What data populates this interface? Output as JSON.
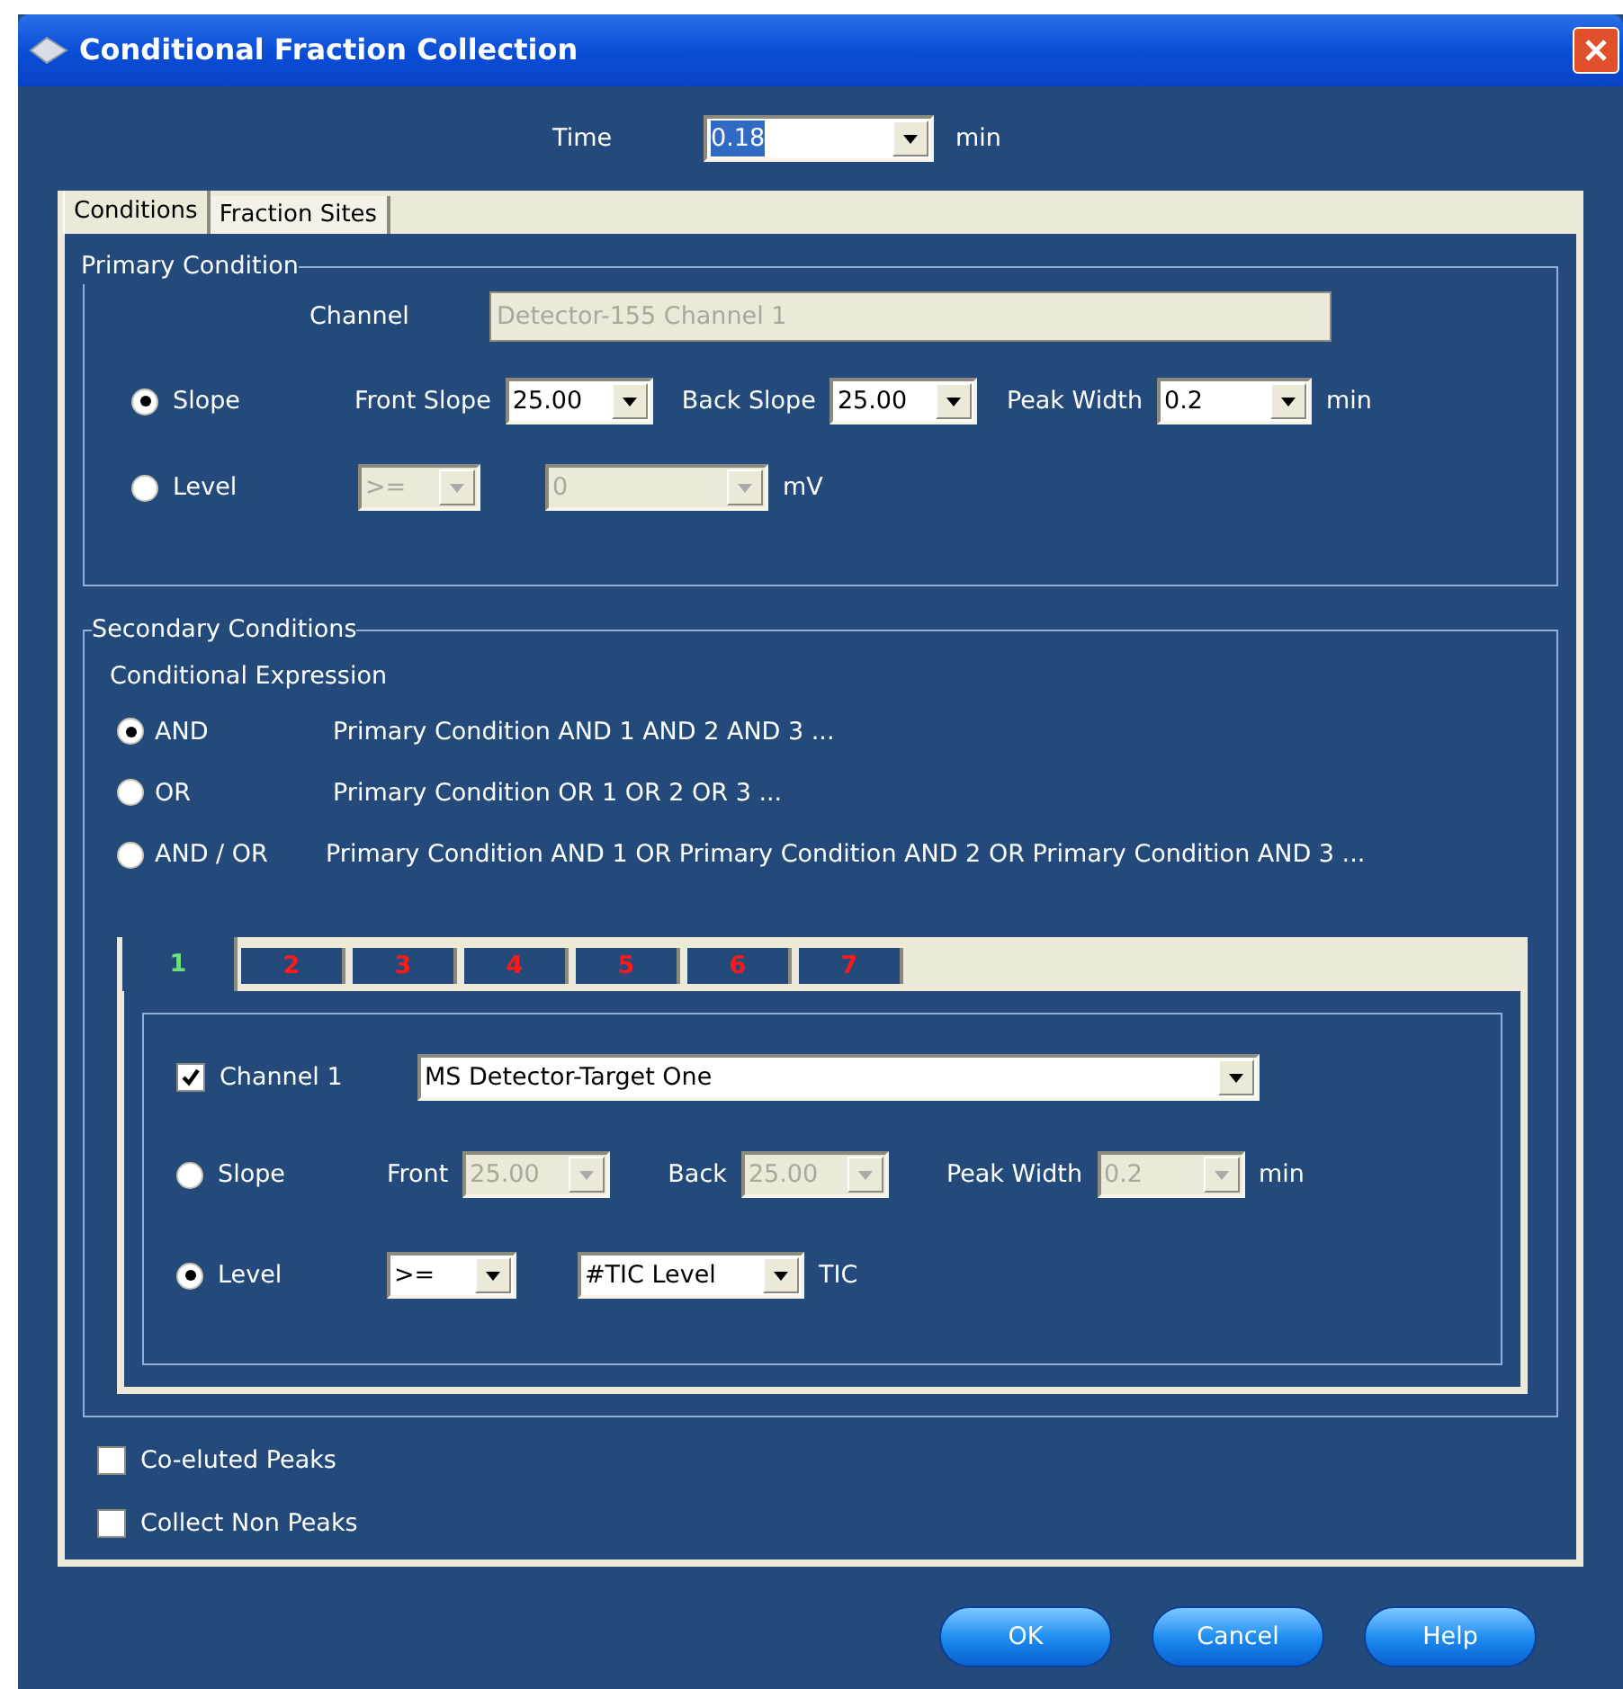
{
  "window": {
    "title": "Conditional Fraction Collection"
  },
  "time": {
    "label": "Time",
    "value": "0.18",
    "unit": "min"
  },
  "tabs": [
    {
      "label": "Conditions",
      "selected": true
    },
    {
      "label": "Fraction Sites",
      "selected": false
    }
  ],
  "primary_condition": {
    "title": "Primary Condition",
    "channel_label": "Channel",
    "channel_value": "Detector-155 Channel 1",
    "modes": [
      {
        "label": "Slope",
        "selected": true,
        "fields": [
          {
            "label": "Front Slope",
            "value": "25.00",
            "disabled": false
          },
          {
            "label": "Back Slope",
            "value": "25.00",
            "disabled": false
          },
          {
            "label": "Peak Width",
            "value": "0.2",
            "disabled": false
          }
        ],
        "unit": "min"
      },
      {
        "label": "Level",
        "selected": false,
        "fields": [
          {
            "value": ">=",
            "disabled": true
          },
          {
            "value": "0",
            "disabled": true
          }
        ],
        "unit": "mV"
      }
    ]
  },
  "secondary_conditions": {
    "title": "Secondary Conditions",
    "expression_label": "Conditional Expression",
    "options": [
      {
        "label": "AND",
        "description": "Primary Condition AND 1 AND 2 AND 3 ...",
        "selected": true
      },
      {
        "label": "OR",
        "description": "Primary Condition OR 1 OR 2 OR 3 ...",
        "selected": false
      },
      {
        "label": "AND / OR",
        "description": "Primary Condition AND 1 OR Primary Condition AND 2 OR Primary Condition AND 3 ...",
        "selected": false
      }
    ],
    "channel_tabs": [
      {
        "label": "1",
        "selected": true
      },
      {
        "label": "2",
        "selected": false
      },
      {
        "label": "3",
        "selected": false
      },
      {
        "label": "4",
        "selected": false
      },
      {
        "label": "5",
        "selected": false
      },
      {
        "label": "6",
        "selected": false
      },
      {
        "label": "7",
        "selected": false
      }
    ],
    "channel": {
      "label": "Channel 1",
      "checked": true,
      "value": "MS Detector-Target One"
    },
    "modes": [
      {
        "label": "Slope",
        "selected": false,
        "fields": [
          {
            "label": "Front",
            "value": "25.00",
            "disabled": true
          },
          {
            "label": "Back",
            "value": "25.00",
            "disabled": true
          },
          {
            "label": "Peak Width",
            "value": "0.2",
            "disabled": true
          }
        ],
        "unit": "min"
      },
      {
        "label": "Level",
        "selected": true,
        "fields": [
          {
            "value": ">=",
            "disabled": false
          },
          {
            "value": "#TIC Level",
            "disabled": false
          }
        ],
        "unit": "TIC"
      }
    ]
  },
  "options": [
    {
      "label": "Co-eluted Peaks",
      "checked": false
    },
    {
      "label": "Collect Non Peaks",
      "checked": false
    }
  ],
  "buttons": [
    "OK",
    "Cancel",
    "Help"
  ]
}
